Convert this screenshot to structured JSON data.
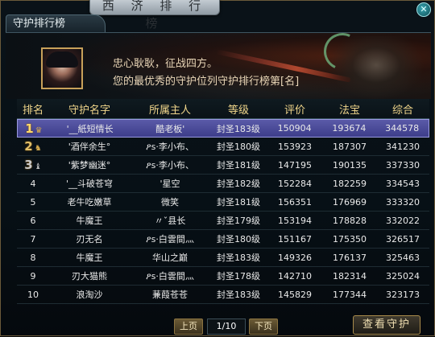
{
  "window": {
    "title": "西 济 排 行 榜",
    "close_label": "✕"
  },
  "tab": {
    "label": "守护排行榜"
  },
  "banner": {
    "line1": "忠心耿耿，征战四方。",
    "line2": "您的最优秀的守护位列守护排行榜第[名]"
  },
  "table": {
    "headers": [
      "排名",
      "守护名字",
      "所属主人",
      "等级",
      "评价",
      "法宝",
      "综合"
    ],
    "rows": [
      {
        "rank": "1",
        "name": "'__紙短情长",
        "owner": "酷老板'",
        "level": "封圣183级",
        "score": "150904",
        "fabao": "193674",
        "total": "344578"
      },
      {
        "rank": "2",
        "name": "'酒伴余生°",
        "owner": "ዖs·李小布、",
        "level": "封圣180级",
        "score": "153923",
        "fabao": "187307",
        "total": "341230"
      },
      {
        "rank": "3",
        "name": "'紫梦幽迷°",
        "owner": "ዖs·李小布、",
        "level": "封圣181级",
        "score": "147195",
        "fabao": "190135",
        "total": "337330"
      },
      {
        "rank": "4",
        "name": "'__斗破苍穹",
        "owner": "'星空",
        "level": "封圣182级",
        "score": "152284",
        "fabao": "182259",
        "total": "334543"
      },
      {
        "rank": "5",
        "name": "老牛吃嫩草",
        "owner": "微笑",
        "level": "封圣181级",
        "score": "156351",
        "fabao": "176969",
        "total": "333320"
      },
      {
        "rank": "6",
        "name": "牛魔王",
        "owner": "〃ˇ县长",
        "level": "封圣179级",
        "score": "153194",
        "fabao": "178828",
        "total": "332022"
      },
      {
        "rank": "7",
        "name": "刃无名",
        "owner": "ዖs·白雲間灬",
        "level": "封圣180级",
        "score": "151167",
        "fabao": "175350",
        "total": "326517"
      },
      {
        "rank": "8",
        "name": "牛魔王",
        "owner": "华山之巅",
        "level": "封圣183级",
        "score": "149326",
        "fabao": "176137",
        "total": "325463"
      },
      {
        "rank": "9",
        "name": "刃大猫熊",
        "owner": "ዖs·白雲間灬",
        "level": "封圣178级",
        "score": "142710",
        "fabao": "182314",
        "total": "325024"
      },
      {
        "rank": "10",
        "name": "浪淘沙",
        "owner": "蒹葭苍苍",
        "level": "封圣183级",
        "score": "145829",
        "fabao": "177344",
        "total": "323173"
      }
    ],
    "selected_row": 1
  },
  "pager": {
    "prev_label": "上页",
    "page": "1/10",
    "next_label": "下页"
  },
  "view_button": {
    "label": "查看守护"
  }
}
